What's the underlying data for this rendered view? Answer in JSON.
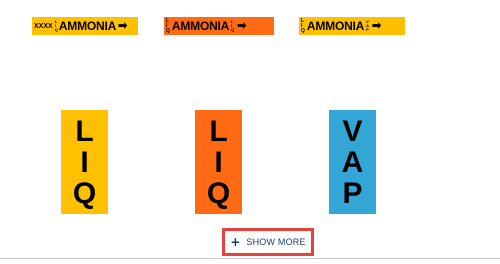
{
  "markers": [
    {
      "prefix": "XXXX",
      "word": "AMMONIA",
      "arrow": "➡",
      "side_marks": [
        "L",
        "I",
        "Q"
      ],
      "color": "#ffc000"
    },
    {
      "prefix_stack": [
        "L",
        "I",
        "Q"
      ],
      "word": "AMMONIA",
      "arrow": "➡",
      "side_marks": [
        "L",
        "I",
        "Q"
      ],
      "color": "#ff6a13"
    },
    {
      "prefix_stack": [
        "L",
        "I",
        "Q"
      ],
      "word": "AMMONIA",
      "arrow": "➡",
      "side_marks": [
        "V",
        "A",
        "P"
      ],
      "color": "#ffc000"
    }
  ],
  "vertical_labels": [
    {
      "letters": [
        "L",
        "I",
        "Q"
      ],
      "color": "#ffc000"
    },
    {
      "letters": [
        "L",
        "I",
        "Q"
      ],
      "color": "#ff6a13"
    },
    {
      "letters": [
        "V",
        "A",
        "P"
      ],
      "color": "#34a6d6"
    }
  ],
  "show_more": {
    "icon": "plus-icon",
    "label": "SHOW MORE",
    "border_color": "#e8403a",
    "text_color": "#1e3a6e"
  }
}
